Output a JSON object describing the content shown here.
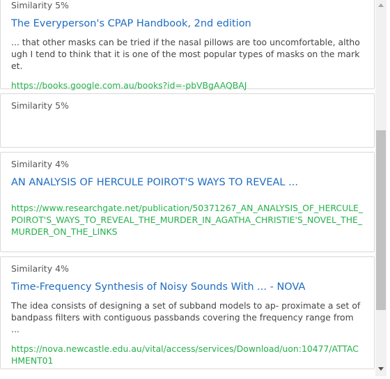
{
  "results": [
    {
      "similarity": "Similarity 5%",
      "title": "The Everyperson's CPAP Handbook, 2nd edition",
      "snippet": "... that other masks can be tried if the nasal pillows are too uncomfortable, although I tend to think that it is one of the most popular types of masks on the market.",
      "url": "https://books.google.com.au/books?id=-pbVBgAAQBAJ"
    },
    {
      "similarity": "Similarity 5%"
    },
    {
      "similarity": "Similarity 4%",
      "title": "AN ANALYSIS OF HERCULE POIROT'S WAYS TO REVEAL ...",
      "url": "https://www.researchgate.net/publication/50371267_AN_ANALYSIS_OF_HERCULE_POIROT'S_WAYS_TO_REVEAL_THE_MURDER_IN_AGATHA_CHRISTIE'S_NOVEL_THE_MURDER_ON_THE_LINKS"
    },
    {
      "similarity": "Similarity 4%",
      "title": "Time-Frequency Synthesis of Noisy Sounds With ... - NOVA",
      "snippet": "The idea consists of designing a set of subband models to ap- proximate a set of bandpass filters with contiguous passbands covering the frequency range from ...",
      "url": "https://nova.newcastle.edu.au/vital/access/services/Download/uon:10477/ATTACHMENT01"
    }
  ],
  "colors": {
    "title": "#1e6cc1",
    "url": "#23b04a",
    "text": "#444444",
    "border": "#d9d9d9"
  },
  "icons": {
    "scroll_up": "triangle-up",
    "scroll_down": "triangle-down"
  }
}
